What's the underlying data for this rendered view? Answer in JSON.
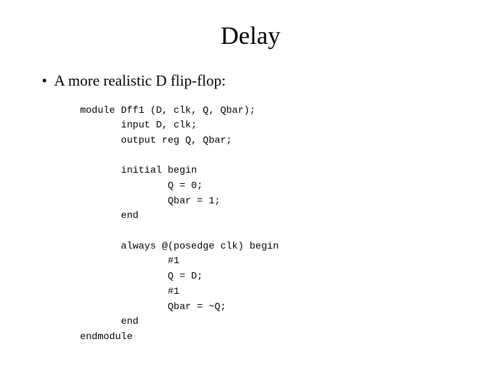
{
  "page": {
    "title": "Delay",
    "bullet": {
      "text": "A more realistic D flip-flop:"
    },
    "code": {
      "line1": "module Dff1 (D, clk, Q, Qbar);",
      "line2": "       input D, clk;",
      "line3": "       output reg Q, Qbar;",
      "line4": "",
      "line5": "       initial begin",
      "line6": "               Q = 0;",
      "line7": "               Qbar = 1;",
      "line8": "       end",
      "line9": "",
      "line10": "       always @(posedge clk) begin",
      "line11": "               #1",
      "line12": "               Q = D;",
      "line13": "               #1",
      "line14": "               Qbar = ~Q;",
      "line15": "       end",
      "line16": "endmodule"
    }
  }
}
